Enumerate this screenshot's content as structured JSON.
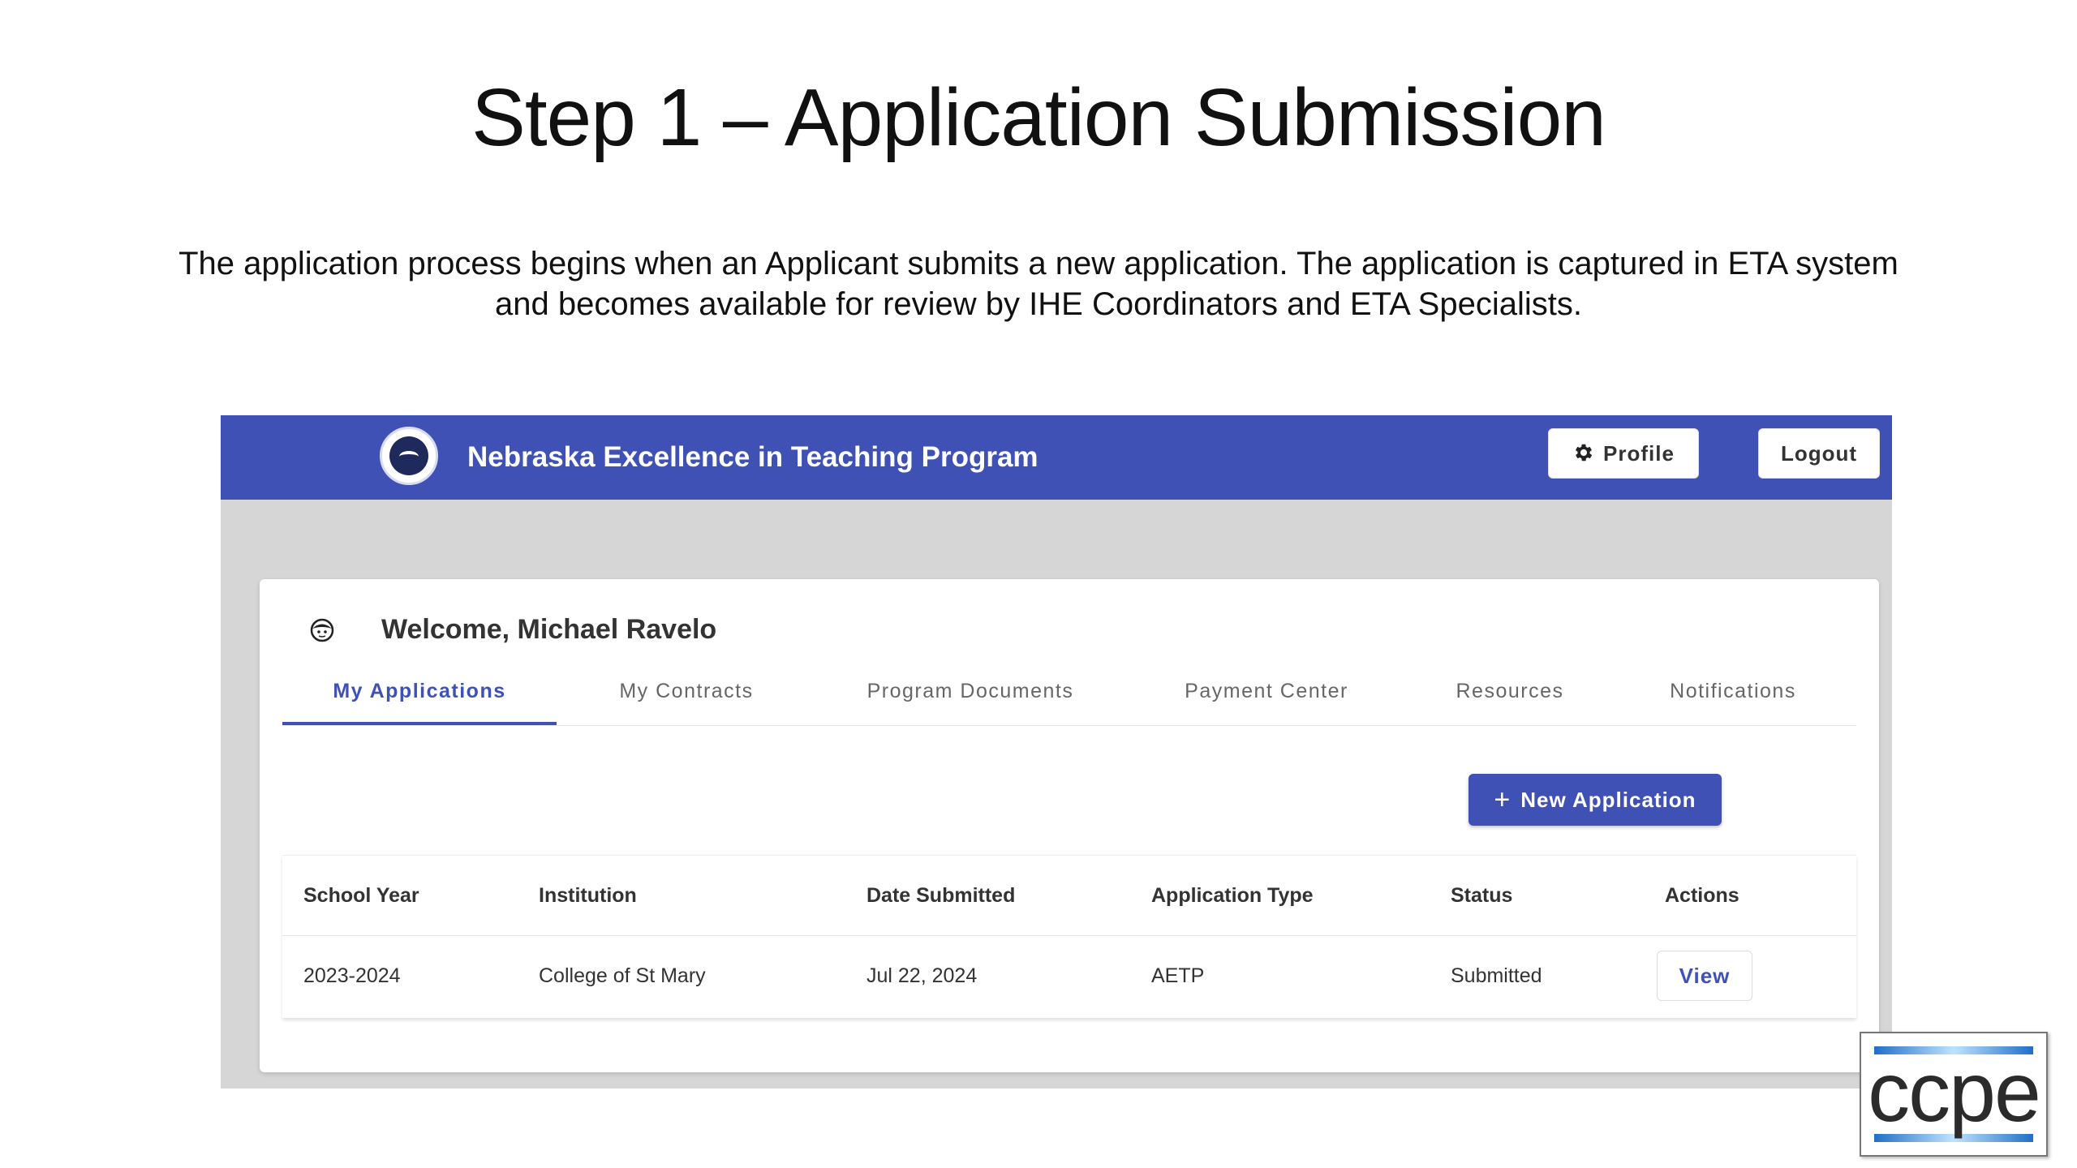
{
  "slide": {
    "title": "Step 1 – Application Submission",
    "description": "The application process begins when an Applicant submits a new application. The application is captured in ETA system and becomes available for review by IHE Coordinators and ETA Specialists."
  },
  "header": {
    "logo_icon": "program-seal-icon",
    "title": "Nebraska Excellence in Teaching Program",
    "profile_label": "Profile",
    "profile_icon": "gear-icon",
    "logout_label": "Logout",
    "accent_color": "#3f51b5"
  },
  "welcome": {
    "avatar_icon": "user-face-icon",
    "text": "Welcome, Michael Ravelo"
  },
  "tabs": [
    {
      "label": "My Applications",
      "active": true
    },
    {
      "label": "My Contracts",
      "active": false
    },
    {
      "label": "Program Documents",
      "active": false
    },
    {
      "label": "Payment Center",
      "active": false
    },
    {
      "label": "Resources",
      "active": false
    },
    {
      "label": "Notifications",
      "active": false
    }
  ],
  "new_application": {
    "icon": "plus-icon",
    "label": "New Application"
  },
  "table": {
    "columns": [
      "School Year",
      "Institution",
      "Date Submitted",
      "Application Type",
      "Status",
      "Actions"
    ],
    "rows": [
      {
        "school_year": "2023-2024",
        "institution": "College of St Mary",
        "date_submitted": "Jul 22, 2024",
        "application_type": "AETP",
        "status": "Submitted",
        "action_label": "View"
      }
    ]
  },
  "corner_logo": {
    "text": "ccpe"
  }
}
